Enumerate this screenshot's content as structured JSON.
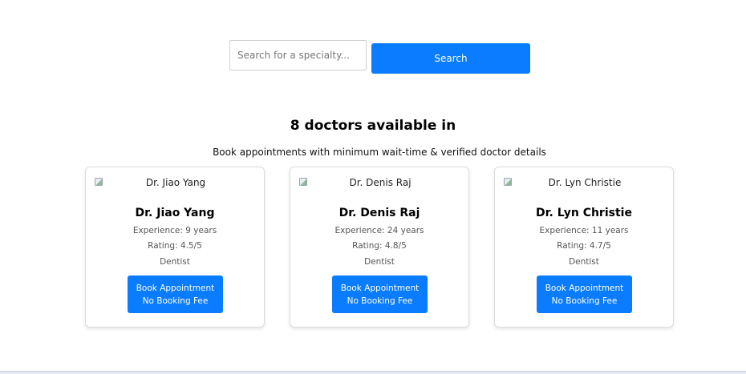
{
  "search": {
    "placeholder": "Search for a specialty...",
    "value": "",
    "button_label": "Search"
  },
  "heading": "8 doctors available in",
  "subheading": "Book appointments with minimum wait-time & verified doctor details",
  "doctors": [
    {
      "image_alt": "Dr. Jiao Yang",
      "name": "Dr. Jiao Yang",
      "experience": "Experience: 9 years",
      "rating": "Rating: 4.5/5",
      "specialty": "Dentist",
      "book_line1": "Book Appointment",
      "book_line2": "No Booking Fee"
    },
    {
      "image_alt": "Dr. Denis Raj",
      "name": "Dr. Denis Raj",
      "experience": "Experience: 24 years",
      "rating": "Rating: 4.8/5",
      "specialty": "Dentist",
      "book_line1": "Book Appointment",
      "book_line2": "No Booking Fee"
    },
    {
      "image_alt": "Dr. Lyn Christie",
      "name": "Dr. Lyn Christie",
      "experience": "Experience: 11 years",
      "rating": "Rating: 4.7/5",
      "specialty": "Dentist",
      "book_line1": "Book Appointment",
      "book_line2": "No Booking Fee"
    }
  ],
  "colors": {
    "primary": "#0a7cff",
    "card_border": "#dcdcdc",
    "muted_text": "#555555"
  },
  "icons": {
    "doctor_image": "broken-image-icon"
  }
}
